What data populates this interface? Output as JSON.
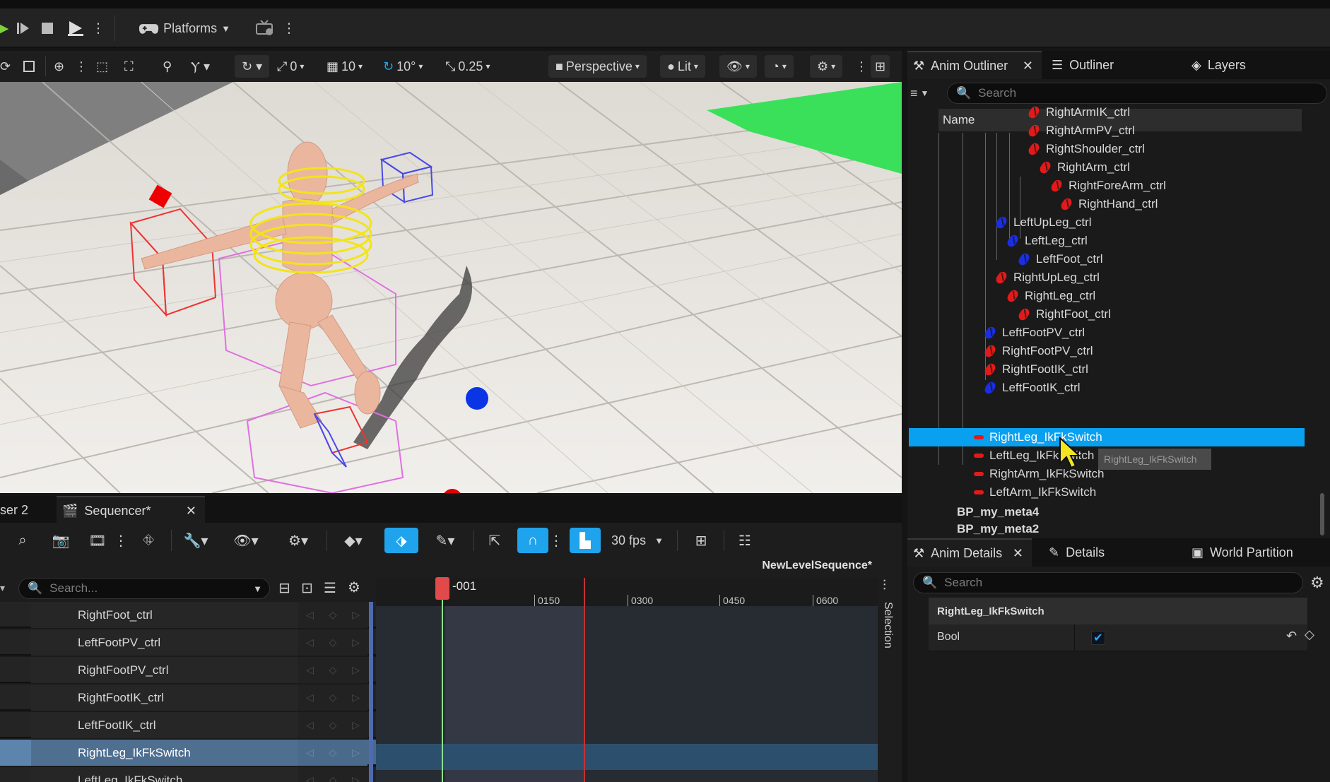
{
  "toolbar": {
    "platforms_label": "Platforms"
  },
  "viewport_toolbar": {
    "angle_snap_value": "0",
    "grid_snap_value": "10",
    "rotation_snap_value": "10°",
    "scale_snap_value": "0.25",
    "perspective_label": "Perspective",
    "lit_label": "Lit"
  },
  "right_panel": {
    "tabs": [
      {
        "label": "Anim Outliner"
      },
      {
        "label": "Outliner"
      },
      {
        "label": "Layers"
      }
    ],
    "search_placeholder": "Search",
    "column_name": "Name",
    "tree": [
      {
        "label": "RightArmIK_ctrl",
        "color": "#e31a1a"
      },
      {
        "label": "RightArmPV_ctrl",
        "color": "#e31a1a"
      },
      {
        "label": "RightShoulder_ctrl",
        "color": "#e31a1a"
      },
      {
        "label": "RightArm_ctrl",
        "color": "#e31a1a"
      },
      {
        "label": "RightForeArm_ctrl",
        "color": "#e31a1a"
      },
      {
        "label": "RightHand_ctrl",
        "color": "#e31a1a"
      },
      {
        "label": "LeftUpLeg_ctrl",
        "color": "#1a2ee3"
      },
      {
        "label": "LeftLeg_ctrl",
        "color": "#1a2ee3"
      },
      {
        "label": "LeftFoot_ctrl",
        "color": "#1a2ee3"
      },
      {
        "label": "RightUpLeg_ctrl",
        "color": "#e31a1a"
      },
      {
        "label": "RightLeg_ctrl",
        "color": "#e31a1a"
      },
      {
        "label": "RightFoot_ctrl",
        "color": "#e31a1a"
      },
      {
        "label": "LeftFootPV_ctrl",
        "color": "#1a2ee3"
      },
      {
        "label": "RightFootPV_ctrl",
        "color": "#e31a1a"
      },
      {
        "label": "RightFootIK_ctrl",
        "color": "#e31a1a"
      },
      {
        "label": "LeftFootIK_ctrl",
        "color": "#1a2ee3"
      },
      {
        "label": "RightLeg_IkFkSwitch",
        "color": "#e31a1a"
      },
      {
        "label": "LeftLeg_IkFkSwitch",
        "color": "#e31a1a"
      },
      {
        "label": "RightArm_IkFkSwitch",
        "color": "#e31a1a"
      },
      {
        "label": "LeftArm_IkFkSwitch",
        "color": "#e31a1a"
      },
      {
        "label": "BP_my_meta4"
      },
      {
        "label": "BP_my_meta2"
      }
    ],
    "tooltip": "RightLeg_IkFkSwitch"
  },
  "details": {
    "tabs": [
      {
        "label": "Anim Details"
      },
      {
        "label": "Details"
      },
      {
        "label": "World Partition"
      }
    ],
    "search_placeholder": "Search",
    "section_title": "RightLeg_IkFkSwitch",
    "property_label": "Bool",
    "property_value": true
  },
  "sequencer": {
    "tabs": [
      {
        "label": "ser 2"
      },
      {
        "label": "Sequencer*"
      }
    ],
    "fps_label": "30 fps",
    "sequence_name": "NewLevelSequence*",
    "search_placeholder": "Search...",
    "playhead_label": "-001",
    "ruler_ticks": [
      "0150",
      "0300",
      "0450",
      "0600"
    ],
    "selection_label": "Selection",
    "tracks": [
      {
        "label": "RightFoot_ctrl"
      },
      {
        "label": "LeftFootPV_ctrl"
      },
      {
        "label": "RightFootPV_ctrl"
      },
      {
        "label": "RightFootIK_ctrl"
      },
      {
        "label": "LeftFootIK_ctrl"
      },
      {
        "label": "RightLeg_IkFkSwitch"
      },
      {
        "label": "LeftLeg_IkFkSwitch"
      }
    ]
  },
  "colors": {
    "accent_blue": "#1fa3ec",
    "selection_blue": "#0aa0f0",
    "ctrl_red": "#e31a1a",
    "ctrl_blue": "#1a2ee3"
  }
}
